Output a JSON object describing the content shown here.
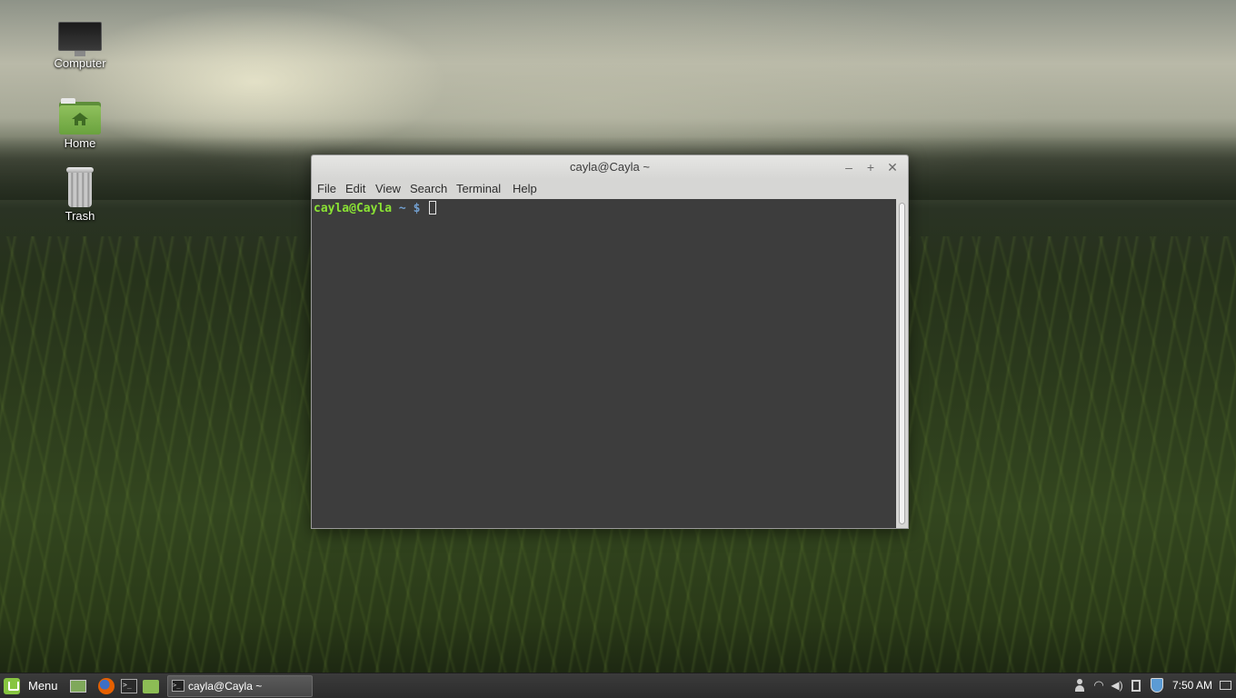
{
  "desktop": {
    "icons": [
      {
        "label": "Computer",
        "icon": "computer-icon"
      },
      {
        "label": "Home",
        "icon": "home-folder-icon"
      },
      {
        "label": "Trash",
        "icon": "trash-icon"
      }
    ]
  },
  "terminal": {
    "title": "cayla@Cayla ~",
    "controls": {
      "minimize": "–",
      "maximize": "+",
      "close": "✕"
    },
    "menu": [
      "File",
      "Edit",
      "View",
      "Search",
      "Terminal",
      "Help"
    ],
    "prompt": {
      "user_host": "cayla@Cayla",
      "path": "~",
      "symbol": "$"
    },
    "colors": {
      "background": "#3d3d3d",
      "user_host": "#8ae234",
      "path": "#729fcf"
    }
  },
  "panel": {
    "menu_label": "Menu",
    "launchers": [
      "show-desktop-icon",
      "firefox-icon",
      "terminal-icon",
      "files-icon"
    ],
    "tasks": [
      {
        "label": "cayla@Cayla ~",
        "icon": "terminal-icon"
      }
    ],
    "tray": [
      "user-icon",
      "wifi-icon",
      "volume-icon",
      "battery-icon",
      "update-shield-icon"
    ],
    "clock": "7:50 AM"
  }
}
